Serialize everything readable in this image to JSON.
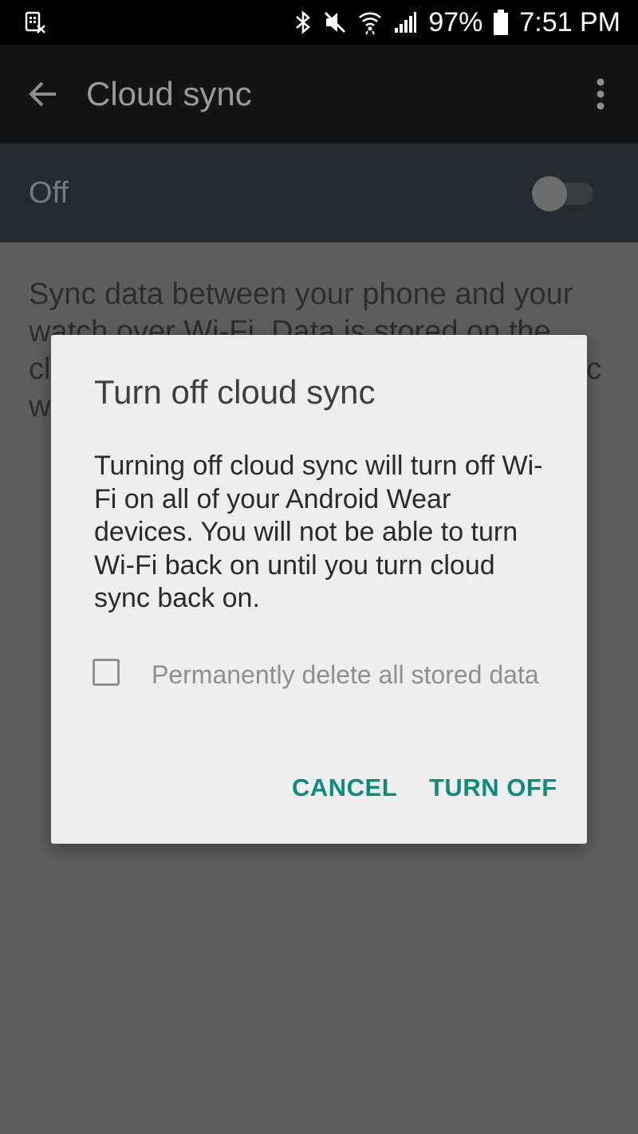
{
  "status_bar": {
    "battery": "97%",
    "time": "7:51 PM",
    "icons": [
      "screenshot-icon",
      "bluetooth-icon",
      "mute-icon",
      "wifi-icon",
      "signal-icon",
      "battery-icon"
    ]
  },
  "app_bar": {
    "title": "Cloud sync",
    "back_icon": "arrow-back-icon",
    "menu_icon": "more-vert-icon"
  },
  "master_switch": {
    "label": "Off",
    "checked": false
  },
  "description": "Sync data between your phone and your watch over Wi-Fi. Data is stored on the cloud and used to sync your devices. Sync when you're not on the same network.",
  "dialog": {
    "title": "Turn off cloud sync",
    "message": "Turning off cloud sync will turn off Wi-Fi on all of your Android Wear devices. You will not be able to turn Wi-Fi back on until you turn cloud sync back on.",
    "checkbox_label": "Permanently delete all stored data",
    "checkbox_checked": false,
    "cancel_label": "CANCEL",
    "confirm_label": "TURN OFF"
  },
  "colors": {
    "accent": "#0c8b7e",
    "scrim": "#5e5e5e",
    "dialog_bg": "#eeeeee",
    "app_bar": "#141414",
    "switch_bar": "#262b30"
  }
}
